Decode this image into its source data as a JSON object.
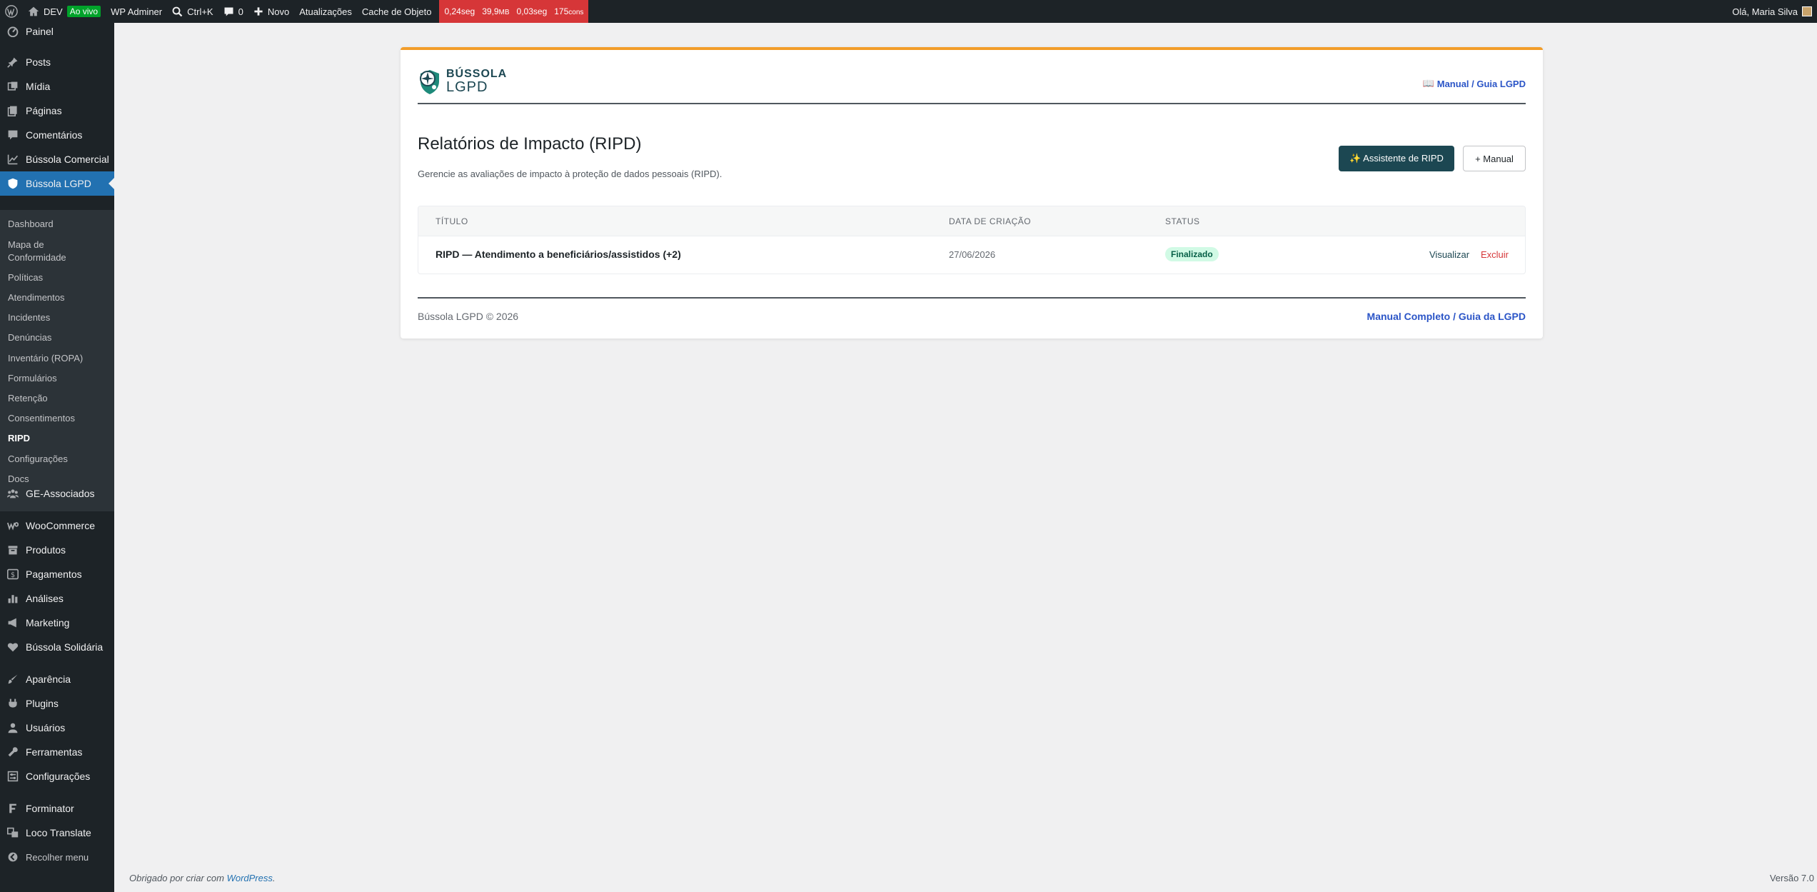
{
  "adminbar": {
    "site_name": "DEV",
    "live_badge": "Ao vivo",
    "wp_adminer": "WP Adminer",
    "search_shortcut": "Ctrl+K",
    "comments_count": "0",
    "new_label": "Novo",
    "updates_label": "Atualizações",
    "object_cache_label": "Cache de Objeto",
    "perf_time": "0,24seg",
    "perf_memory": "39,9",
    "perf_memory_unit": "MB",
    "perf_query_time": "0,03seg",
    "perf_queries": "175",
    "perf_queries_unit": "cons",
    "greeting": "Olá, Maria Silva"
  },
  "sidebar": {
    "items": [
      {
        "label": "Painel",
        "icon": "dashboard-icon"
      },
      {
        "label": "Posts",
        "icon": "pin-icon"
      },
      {
        "label": "Mídia",
        "icon": "media-icon"
      },
      {
        "label": "Páginas",
        "icon": "pages-icon"
      },
      {
        "label": "Comentários",
        "icon": "comment-icon"
      },
      {
        "label": "Bússola Comercial",
        "icon": "chart-line-icon"
      },
      {
        "label": "Bússola LGPD",
        "icon": "shield-icon"
      },
      {
        "label": "GE-Associados",
        "icon": "groups-icon"
      },
      {
        "label": "WooCommerce",
        "icon": "woo-icon"
      },
      {
        "label": "Produtos",
        "icon": "archive-icon"
      },
      {
        "label": "Pagamentos",
        "icon": "dollar-icon"
      },
      {
        "label": "Análises",
        "icon": "bar-chart-icon"
      },
      {
        "label": "Marketing",
        "icon": "megaphone-icon"
      },
      {
        "label": "Bússola Solidária",
        "icon": "heart-icon"
      },
      {
        "label": "Aparência",
        "icon": "brush-icon"
      },
      {
        "label": "Plugins",
        "icon": "plugin-icon"
      },
      {
        "label": "Usuários",
        "icon": "user-icon"
      },
      {
        "label": "Ferramentas",
        "icon": "wrench-icon"
      },
      {
        "label": "Configurações",
        "icon": "settings-icon"
      },
      {
        "label": "Forminator",
        "icon": "form-icon"
      },
      {
        "label": "Loco Translate",
        "icon": "translate-icon"
      },
      {
        "label": "Recolher menu",
        "icon": "collapse-icon"
      }
    ],
    "submenu": [
      "Dashboard",
      "Mapa de",
      "Conformidade",
      "Políticas",
      "Atendimentos",
      "Incidentes",
      "Denúncias",
      "Inventário (ROPA)",
      "Formulários",
      "Retenção",
      "Consentimentos",
      "RIPD",
      "Configurações",
      "Docs"
    ]
  },
  "card": {
    "logo_line1": "BÚSSOLA",
    "logo_line2": "LGPD",
    "header_link": "Manual / Guia LGPD",
    "title": "Relatórios de Impacto (RIPD)",
    "description": "Gerencie as avaliações de impacto à proteção de dados pessoais (RIPD).",
    "assistant_button": "✨ Assistente de RIPD",
    "manual_button": "+ Manual",
    "table": {
      "headers": [
        "TÍTULO",
        "DATA DE CRIAÇÃO",
        "STATUS"
      ],
      "rows": [
        {
          "title": "RIPD — Atendimento a beneficiários/assistidos (+2)",
          "date": "27/06/2026",
          "status": "Finalizado",
          "view": "Visualizar",
          "delete": "Excluir"
        }
      ]
    },
    "footer_copy": "Bússola LGPD © 2026",
    "footer_link": "Manual Completo / Guia da LGPD"
  },
  "wp_footer": {
    "thanks_prefix": "Obrigado por criar com",
    "thanks_link": "WordPress",
    "thanks_suffix": ".",
    "version": "Versão 7.0"
  },
  "colors": {
    "accent": "#2271b1",
    "brand_dark": "#1c4752",
    "card_top_border": "#f29d2a",
    "status_green_bg": "#d1fae5",
    "delete_red": "#d63638",
    "perf_red": "#d63638"
  }
}
